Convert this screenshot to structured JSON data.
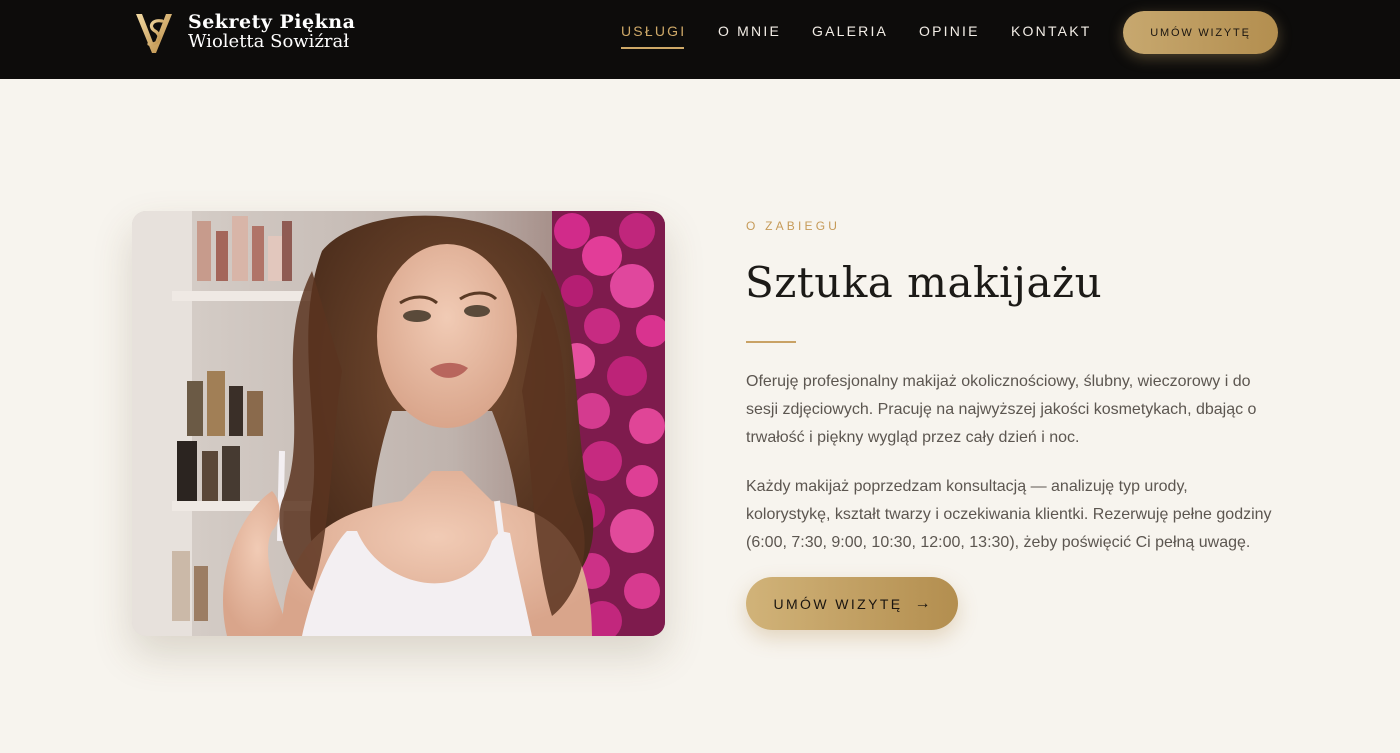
{
  "brand": {
    "line1": "Sekrety Piękna",
    "line2": "Wioletta Sowiźrał"
  },
  "nav": {
    "items": [
      {
        "label": "USŁUGI",
        "active": true
      },
      {
        "label": "O MNIE",
        "active": false
      },
      {
        "label": "GALERIA",
        "active": false
      },
      {
        "label": "OPINIE",
        "active": false
      },
      {
        "label": "KONTAKT",
        "active": false
      }
    ],
    "cta_label": "UMÓW WIZYTĘ"
  },
  "section": {
    "eyebrow": "O ZABIEGU",
    "title": "Sztuka makijażu",
    "paragraph1": "Oferuję profesjonalny makijaż okolicznościowy, ślubny, wieczorowy i do sesji zdjęciowych. Pracuję na najwyższej jakości kosmetykach, dbając o trwałość i piękny wygląd przez cały dzień i noc.",
    "paragraph2": "Każdy makijaż poprzedzam konsultacją — analizuję typ urody, kolorystykę, kształt twarzy i oczekiwania klientki. Rezerwuję pełne godziny (6:00, 7:30, 9:00, 10:30, 12:00, 13:30), żeby poświęcić Ci pełną uwagę.",
    "cta_label": "UMÓW WIZYTĘ",
    "cta_icon": "arrow-right-icon"
  },
  "colors": {
    "header_bg": "#0d0c0b",
    "page_bg": "#f7f4ee",
    "accent_gold": "#c9a265",
    "text_dark": "#1c1a17",
    "text_body": "#5c5650"
  },
  "icons": {
    "logo": "monogram-vs-logo-icon"
  }
}
